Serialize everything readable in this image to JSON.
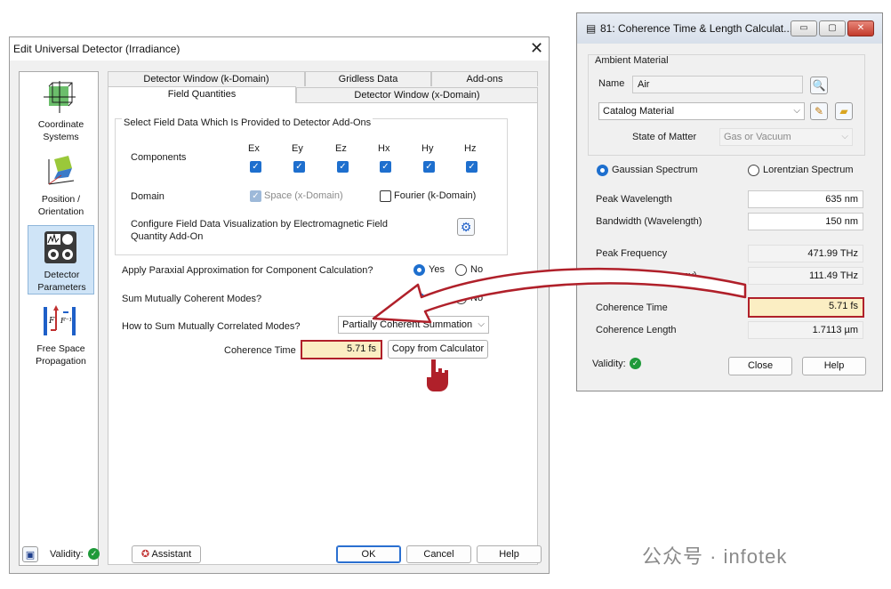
{
  "main_dialog": {
    "title": "Edit Universal Detector (Irradiance)",
    "close_glyph": "✕",
    "sidebar": [
      {
        "label": "Coordinate Systems",
        "icon": "coordinate-systems-icon"
      },
      {
        "label": "Position / Orientation",
        "icon": "position-orientation-icon"
      },
      {
        "label": "Detector Parameters",
        "icon": "detector-parameters-icon",
        "active": true
      },
      {
        "label": "Free Space Propagation",
        "icon": "free-space-propagation-icon"
      }
    ],
    "tabs_row1": [
      "Detector Window (k-Domain)",
      "Gridless Data",
      "Add-ons"
    ],
    "tabs_row2": [
      "Field Quantities",
      "Detector Window (x-Domain)"
    ],
    "group_title": "Select Field Data Which Is Provided to Detector Add-Ons",
    "components_label": "Components",
    "components": [
      "Ex",
      "Ey",
      "Ez",
      "Hx",
      "Hy",
      "Hz"
    ],
    "domain_label": "Domain",
    "domain_space": "Space (x-Domain)",
    "domain_fourier": "Fourier (k-Domain)",
    "configure_text": "Configure Field Data Visualization by Electromagnetic Field Quantity Add-On",
    "paraxial_q": "Apply Paraxial Approximation for Component Calculation?",
    "sum_coherent_q": "Sum Mutually Coherent Modes?",
    "sum_correlated_q": "How to Sum Mutually Correlated Modes?",
    "yes": "Yes",
    "no": "No",
    "sum_mode_value": "Partially Coherent Summation",
    "coherence_time_label": "Coherence Time",
    "coherence_time_value": "5.71 fs",
    "copy_button": "Copy from Calculator",
    "validity_label": "Validity:",
    "assistant_button": "Assistant",
    "ok_button": "OK",
    "cancel_button": "Cancel",
    "help_button": "Help"
  },
  "calculator": {
    "title": "81: Coherence Time & Length Calculat...",
    "ambient_material": "Ambient Material",
    "name_label": "Name",
    "name_value": "Air",
    "catalog_value": "Catalog Material",
    "state_label": "State of Matter",
    "state_value": "Gas or Vacuum",
    "gaussian": "Gaussian Spectrum",
    "lorentzian": "Lorentzian Spectrum",
    "rows": [
      {
        "label": "Peak Wavelength",
        "value": "635 nm"
      },
      {
        "label": "Bandwidth (Wavelength)",
        "value": "150 nm"
      },
      {
        "label": "Peak Frequency",
        "value": "471.99 THz"
      },
      {
        "label": "Bandwidth (Frequency)",
        "value": "111.49 THz"
      },
      {
        "label": "Coherence Time",
        "value": "5.71 fs"
      },
      {
        "label": "Coherence Length",
        "value": "1.7113 µm"
      }
    ],
    "validity_label": "Validity:",
    "close_button": "Close",
    "help_button": "Help"
  },
  "watermark": "公众号 · infotek",
  "colors": {
    "highlight_border": "#b0202a",
    "highlight_fill": "#fbeec3",
    "accent": "#1e6fce"
  }
}
